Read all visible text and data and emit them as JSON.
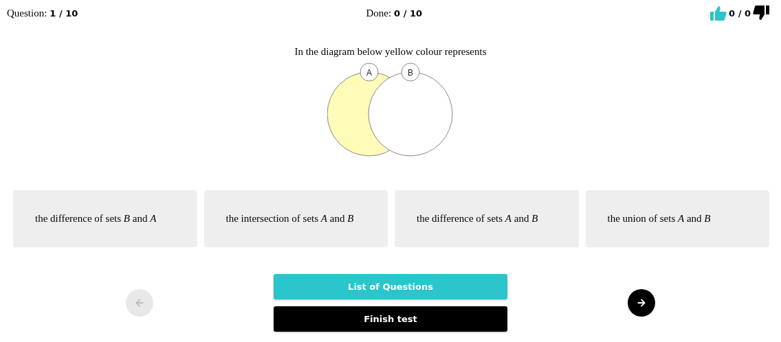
{
  "header": {
    "question_label": "Question:",
    "question_value": "1 / 10",
    "done_label": "Done:",
    "done_value": "0 / 10",
    "score": "0 / 0"
  },
  "question": "In the diagram below yellow colour represents",
  "venn": {
    "sets": [
      {
        "label": "A",
        "color": "#fffbb8"
      },
      {
        "label": "B",
        "color": "#ffffff"
      }
    ]
  },
  "options": [
    {
      "text": "the difference of sets *B* and *A*"
    },
    {
      "text": "the intersection of sets *A* and *B*"
    },
    {
      "text": "the difference of sets *A* and *B*"
    },
    {
      "text": "the union of sets *A* and *B*"
    }
  ],
  "nav": {
    "prev": {
      "disabled": true
    },
    "next": {
      "disabled": false
    }
  },
  "buttons": [
    {
      "label": "List of Questions",
      "kind": "primary"
    },
    {
      "label": "Finish test",
      "kind": "dark"
    }
  ]
}
